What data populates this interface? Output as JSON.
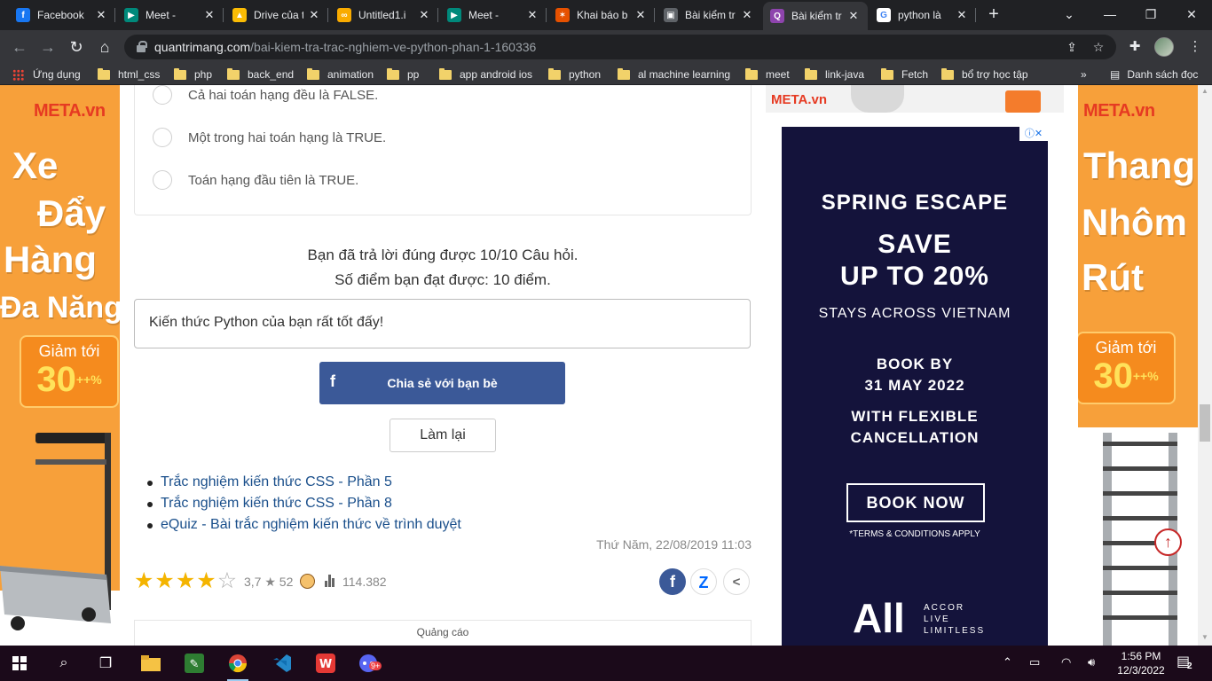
{
  "browser": {
    "tabs": [
      {
        "label": "Facebook",
        "icon": "facebook-icon",
        "color": "#1877f2",
        "glyph": "f"
      },
      {
        "label": "Meet - ",
        "icon": "meet-icon",
        "color": "#00897b",
        "glyph": "▶"
      },
      {
        "label": "Drive của t",
        "icon": "drive-icon",
        "color": "#fbbc04",
        "glyph": "▲"
      },
      {
        "label": "Untitled1.i",
        "icon": "colab-icon",
        "color": "#f9ab00",
        "glyph": "∞"
      },
      {
        "label": "Meet - ",
        "icon": "meet-icon",
        "color": "#00897b",
        "glyph": "▶"
      },
      {
        "label": "Khai báo b",
        "icon": "pinwheel-icon",
        "color": "#e65100",
        "glyph": "✶"
      },
      {
        "label": "Bài kiểm tr",
        "icon": "classroom-icon",
        "color": "#5f6368",
        "glyph": "▣"
      },
      {
        "label": "Bài kiểm tr",
        "icon": "quiz-icon",
        "color": "#8e44ad",
        "glyph": "Q"
      },
      {
        "label": "python là ",
        "icon": "google-icon",
        "color": "#ffffff",
        "glyph": "G"
      }
    ],
    "new_tab": "+",
    "url_host": "quantrimang.com",
    "url_path": "/bai-kiem-tra-trac-nghiem-ve-python-phan-1-160336"
  },
  "bookmarks": {
    "apps": "Ứng dụng",
    "items": [
      "html_css",
      "php",
      "back_end",
      "animation",
      "pp",
      "app android ios",
      "python",
      "al machine learning",
      "meet",
      "link-java",
      "Fetch",
      "bổ trợ học tập"
    ],
    "more": "»",
    "reading_list": "Danh sách đọc"
  },
  "quiz": {
    "options": [
      "Cả hai toán hạng đều là FALSE.",
      "Một trong hai toán hạng là TRUE.",
      "Toán hạng đầu tiên là TRUE."
    ],
    "result_line1": "Bạn đã trả lời đúng được 10/10 Câu hỏi.",
    "result_line2": "Số điểm bạn đạt được: 10 điểm.",
    "message": "Kiến thức Python của bạn rất tốt đấy!",
    "share_label": "Chia sẻ với bạn bè",
    "retry_label": "Làm lại"
  },
  "related": [
    "Trắc nghiệm kiến thức CSS - Phần 5",
    "Trắc nghiệm kiến thức CSS - Phần 8",
    "eQuiz - Bài trắc nghiệm kiến thức về trình duyệt"
  ],
  "meta": {
    "date": "Thứ Năm, 22/08/2019 11:03",
    "rating": "3,7 ★ 52",
    "stars_filled": 4,
    "stars_total": 5,
    "views": "114.382",
    "ad_label": "Quảng cáo"
  },
  "left_ad": {
    "brand": "META.vn",
    "lines": [
      "Xe",
      "Đẩy",
      "Hàng",
      "Đa Năng"
    ],
    "promo_top": "Giảm tới",
    "promo_value": "30",
    "promo_sup": "++\n%"
  },
  "right_ad": {
    "brand": "META.vn",
    "lines": [
      "Thang",
      "Nhôm",
      "Rút"
    ],
    "promo_top": "Giảm tới",
    "promo_value": "30",
    "promo_sup": "++\n%"
  },
  "top_ad": {
    "brand": "META.vn"
  },
  "accor_ad": {
    "headline": "SPRING ESCAPE",
    "save1": "SAVE",
    "save2": "UP TO 20%",
    "stays": "STAYS ACROSS VIETNAM",
    "book_by": "BOOK BY",
    "date": "31 MAY 2022",
    "flex1": "WITH FLEXIBLE",
    "flex2": "CANCELLATION",
    "cta": "BOOK NOW",
    "terms": "*TERMS & CONDITIONS APPLY",
    "logo": "All",
    "tagline1": "ACCOR",
    "tagline2": "LIVE",
    "tagline3": "LIMITLESS"
  },
  "taskbar": {
    "time": "1:56 PM",
    "date": "12/3/2022",
    "notifications": "2",
    "discord_badge": "9+"
  }
}
